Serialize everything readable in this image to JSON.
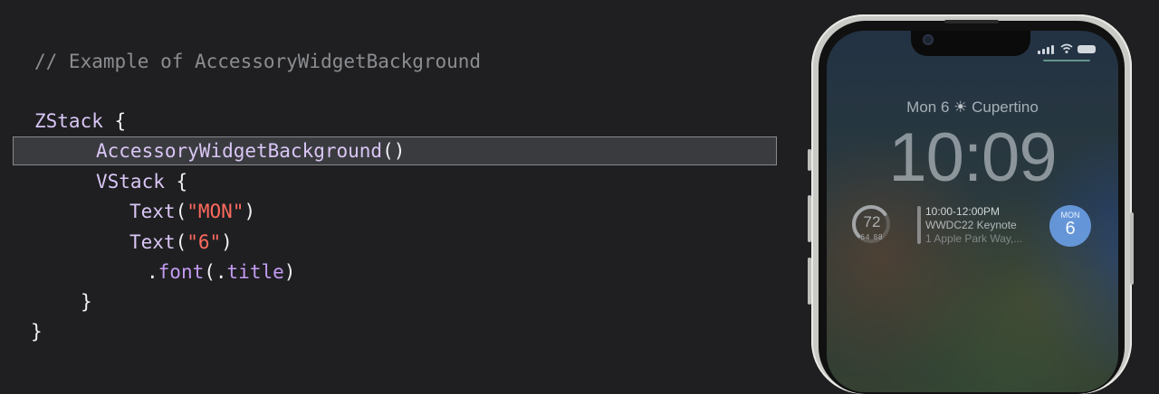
{
  "code": {
    "comment": "// Example of AccessoryWidgetBackground",
    "zstack": "ZStack",
    "open_brace": " {",
    "accessory_call": "AccessoryWidgetBackground",
    "parens": "()",
    "vstack": "VStack",
    "text_kw": "Text",
    "paren_open": "(",
    "paren_close": ")",
    "str_mon": "\"MON\"",
    "str_6": "\"6\"",
    "font_prefix": ".",
    "font_kw": "font",
    "title_prefix": "(.",
    "title_kw": "title",
    "close_inner": "}",
    "close_outer": "}"
  },
  "lock_screen": {
    "date": "Mon 6",
    "sun_icon": "☀",
    "location": "Cupertino",
    "time": "10:09",
    "weather": {
      "temp": "72",
      "range": "64 88",
      "progress": 0.7
    },
    "calendar": {
      "time": "10:00-12:00PM",
      "title": "WWDC22 Keynote",
      "location": "1 Apple Park Way,..."
    },
    "date_badge": {
      "month": "MON",
      "day": "6"
    },
    "wifi_icon": "◠"
  }
}
